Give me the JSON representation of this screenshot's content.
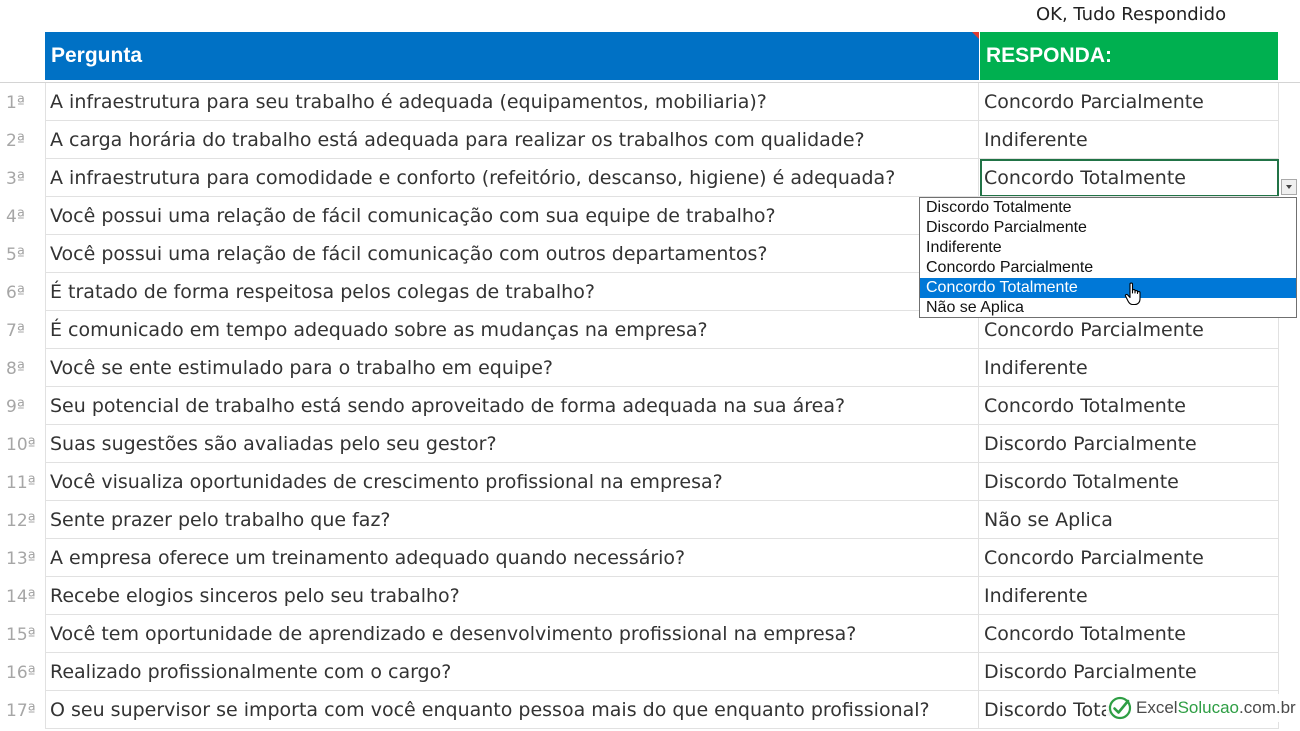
{
  "status_text": "OK, Tudo Respondido",
  "header": {
    "question_label": "Pergunta",
    "answer_label": "RESPONDA:"
  },
  "rows": [
    {
      "num": "1ª",
      "question": "A infraestrutura para seu trabalho é adequada (equipamentos, mobiliaria)?",
      "answer": "Concordo Parcialmente"
    },
    {
      "num": "2ª",
      "question": "A carga horária do trabalho está adequada para realizar os trabalhos com qualidade?",
      "answer": "Indiferente"
    },
    {
      "num": "3ª",
      "question": "A infraestrutura para comodidade e conforto (refeitório, descanso, higiene) é adequada?",
      "answer": "Concordo Totalmente"
    },
    {
      "num": "4ª",
      "question": "Você possui uma relação de fácil comunicação com sua equipe de trabalho?",
      "answer": ""
    },
    {
      "num": "5ª",
      "question": "Você possui uma relação de fácil comunicação com outros departamentos?",
      "answer": ""
    },
    {
      "num": "6ª",
      "question": "É tratado de forma respeitosa pelos colegas de trabalho?",
      "answer": ""
    },
    {
      "num": "7ª",
      "question": "É comunicado em tempo adequado sobre as mudanças na empresa?",
      "answer": "Concordo Parcialmente"
    },
    {
      "num": "8ª",
      "question": "Você se ente estimulado para o trabalho em equipe?",
      "answer": "Indiferente"
    },
    {
      "num": "9ª",
      "question": "Seu potencial de trabalho está sendo aproveitado de forma adequada na sua área?",
      "answer": "Concordo Totalmente"
    },
    {
      "num": "10ª",
      "question": "Suas sugestões são avaliadas pelo seu gestor?",
      "answer": "Discordo Parcialmente"
    },
    {
      "num": "11ª",
      "question": "Você visualiza oportunidades de crescimento profissional na empresa?",
      "answer": "Discordo Totalmente"
    },
    {
      "num": "12ª",
      "question": "Sente prazer pelo trabalho que faz?",
      "answer": "Não se Aplica"
    },
    {
      "num": "13ª",
      "question": "A empresa oferece um treinamento adequado quando necessário?",
      "answer": "Concordo Parcialmente"
    },
    {
      "num": "14ª",
      "question": "Recebe elogios sinceros pelo seu trabalho?",
      "answer": "Indiferente"
    },
    {
      "num": "15ª",
      "question": "Você tem oportunidade de aprendizado e desenvolvimento profissional na empresa?",
      "answer": "Concordo Totalmente"
    },
    {
      "num": "16ª",
      "question": "Realizado profissionalmente com o cargo?",
      "answer": "Discordo Parcialmente"
    },
    {
      "num": "17ª",
      "question": "O seu supervisor se importa com você enquanto pessoa mais do que enquanto profissional?",
      "answer": "Discordo Tota"
    }
  ],
  "selected_row": 2,
  "dropdown": {
    "options": [
      "Discordo Totalmente",
      "Discordo Parcialmente",
      "Indiferente",
      "Concordo Parcialmente",
      "Concordo Totalmente",
      "Não se Aplica"
    ],
    "highlighted": 4
  },
  "watermark": {
    "part1": "Excel",
    "part2": "Solucao",
    "part3": ".com.br",
    "color": "#2e9e44"
  },
  "colors": {
    "question_header": "#0071c5",
    "answer_header": "#00b050",
    "highlight": "#0078d7"
  }
}
